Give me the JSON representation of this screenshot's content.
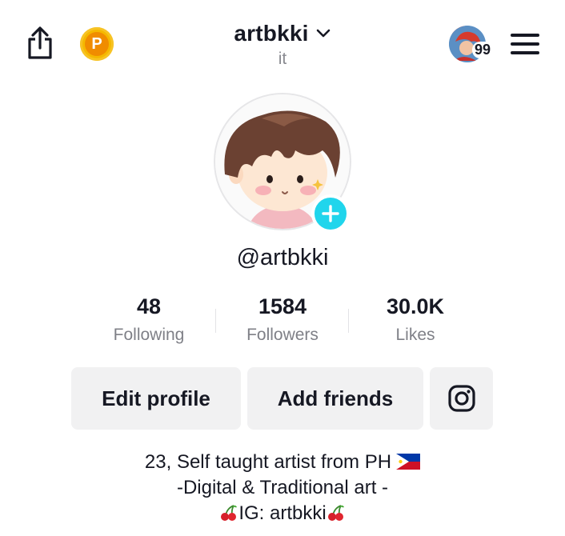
{
  "header": {
    "username": "artbkki",
    "pronouns": "it",
    "story_count": "99"
  },
  "profile": {
    "handle": "@artbkki"
  },
  "stats": [
    {
      "value": "48",
      "label": "Following"
    },
    {
      "value": "1584",
      "label": "Followers"
    },
    {
      "value": "30.0K",
      "label": "Likes"
    }
  ],
  "actions": {
    "edit_profile": "Edit profile",
    "add_friends": "Add friends"
  },
  "bio": {
    "line1": "23, Self taught artist from PH",
    "line2": "-Digital & Traditional art -",
    "line3": "IG: artbkki"
  },
  "icons": {
    "share": "share-icon",
    "coin": "coin-p-icon",
    "chevron": "chevron-down-icon",
    "menu": "hamburger-menu-icon",
    "add": "plus-icon",
    "instagram": "instagram-icon",
    "flag": "philippines-flag-icon",
    "cherry": "cherry-icon"
  },
  "colors": {
    "accent": "#20d5ec",
    "coin": "#f5b800",
    "button_bg": "#f1f1f2",
    "secondary_text": "#7f8087"
  }
}
